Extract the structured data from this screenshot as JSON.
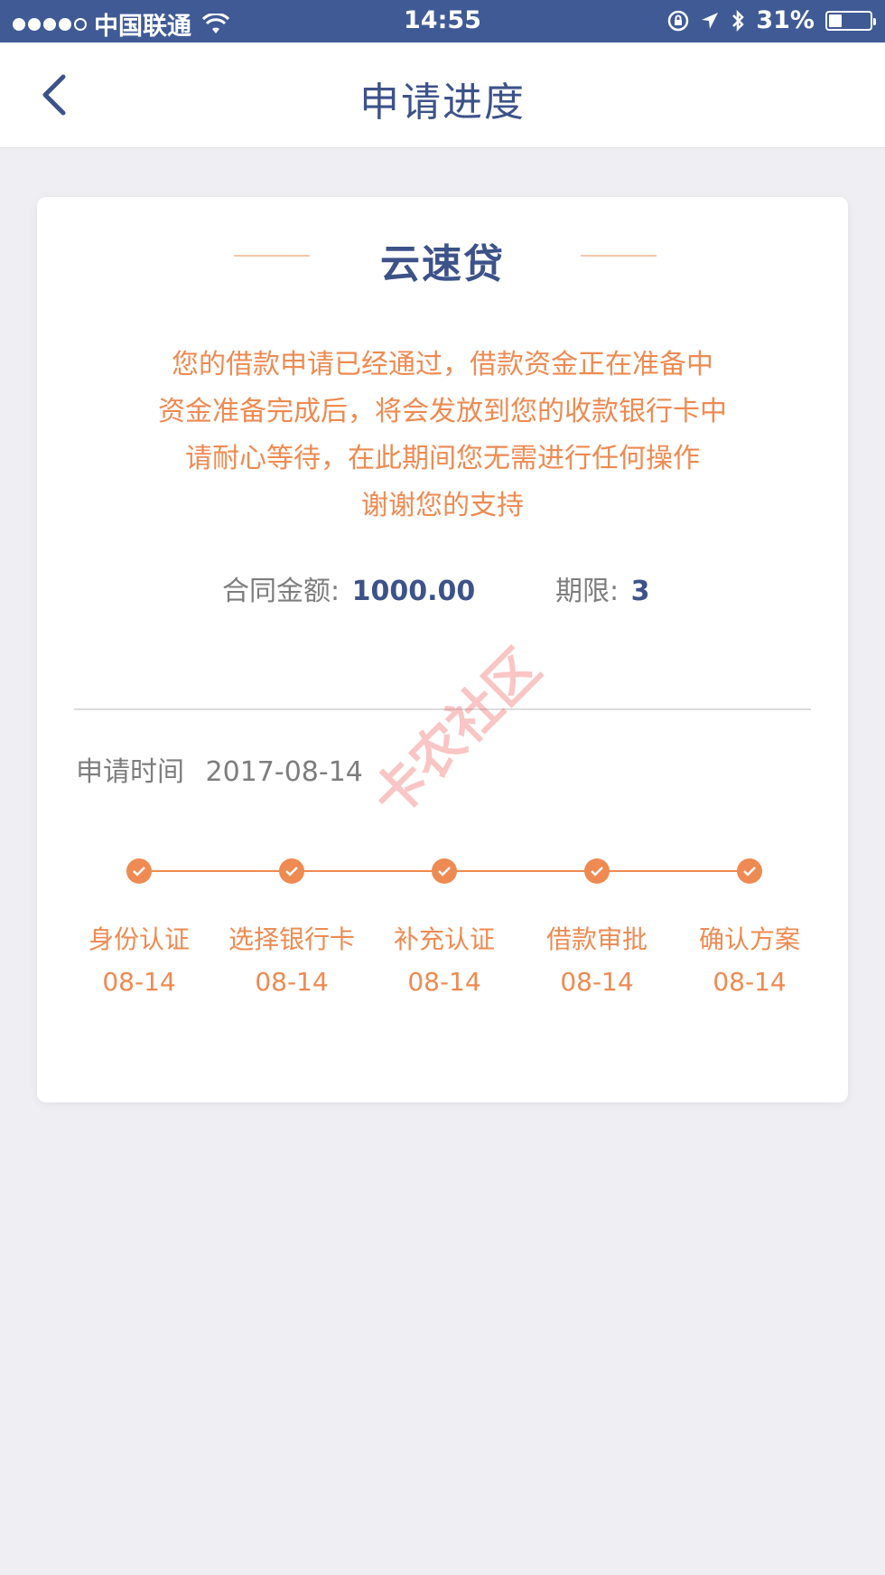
{
  "status_bar": {
    "carrier": "中国联通",
    "time": "14:55",
    "battery": "31%",
    "battery_level": 0.31,
    "icons": [
      "signal-dots",
      "wifi-icon",
      "orientation-lock-icon",
      "location-icon",
      "bluetooth-icon",
      "battery-icon"
    ]
  },
  "nav": {
    "title": "申请进度",
    "back_icon": "chevron-left-icon"
  },
  "card": {
    "product_name": "云速贷",
    "message_lines": [
      "您的借款申请已经通过，借款资金正在准备中",
      "资金准备完成后，将会发放到您的收款银行卡中",
      "请耐心等待，在此期间您无需进行任何操作",
      "谢谢您的支持"
    ],
    "contract_amount_label": "合同金额:",
    "contract_amount_value": "1000.00",
    "term_label": "期限:",
    "term_value": "3",
    "apply_time_label": "申请时间",
    "apply_time_value": "2017-08-14",
    "steps": [
      {
        "label": "身份认证",
        "date": "08-14"
      },
      {
        "label": "选择银行卡",
        "date": "08-14"
      },
      {
        "label": "补充认证",
        "date": "08-14"
      },
      {
        "label": "借款审批",
        "date": "08-14"
      },
      {
        "label": "确认方案",
        "date": "08-14"
      }
    ]
  },
  "watermark": "卡农社区",
  "colors": {
    "status_bar": "#3f5a95",
    "accent_blue": "#3d5289",
    "accent_orange": "#ee8a52",
    "background": "#eeeef3"
  }
}
